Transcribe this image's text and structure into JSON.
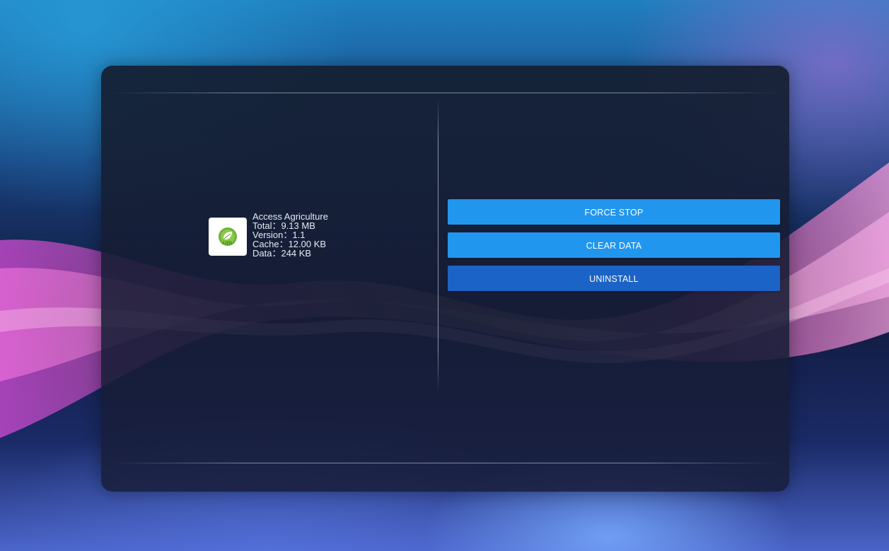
{
  "app": {
    "name": "Access Agriculture",
    "total": "Total：9.13 MB",
    "version": "Version：1.1",
    "cache": "Cache：12.00 KB",
    "data": "Data：244 KB"
  },
  "actions": {
    "force_stop": "FORCE STOP",
    "clear_data": "CLEAR DATA",
    "uninstall": "UNINSTALL"
  },
  "colors": {
    "button_primary": "#2196ef",
    "button_focused": "#1b63c6",
    "panel": "#161d33"
  },
  "icons": {
    "app_icon": "leaf-logo-icon"
  }
}
